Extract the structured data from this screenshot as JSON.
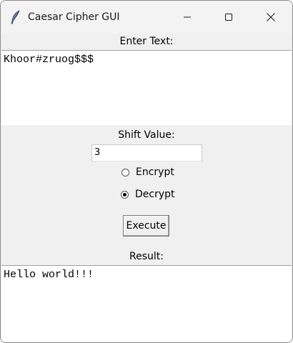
{
  "window": {
    "title": "Caesar Cipher GUI",
    "icon": "feather-icon"
  },
  "input_section": {
    "label": "Enter Text:",
    "value": "Khoor#zruog$$$"
  },
  "shift_section": {
    "label": "Shift Value:",
    "value": "3"
  },
  "mode": {
    "options": [
      {
        "label": "Encrypt",
        "selected": false
      },
      {
        "label": "Decrypt",
        "selected": true
      }
    ]
  },
  "execute_button": {
    "label": "Execute"
  },
  "result_section": {
    "label": "Result:",
    "value": "Hello world!!!"
  }
}
